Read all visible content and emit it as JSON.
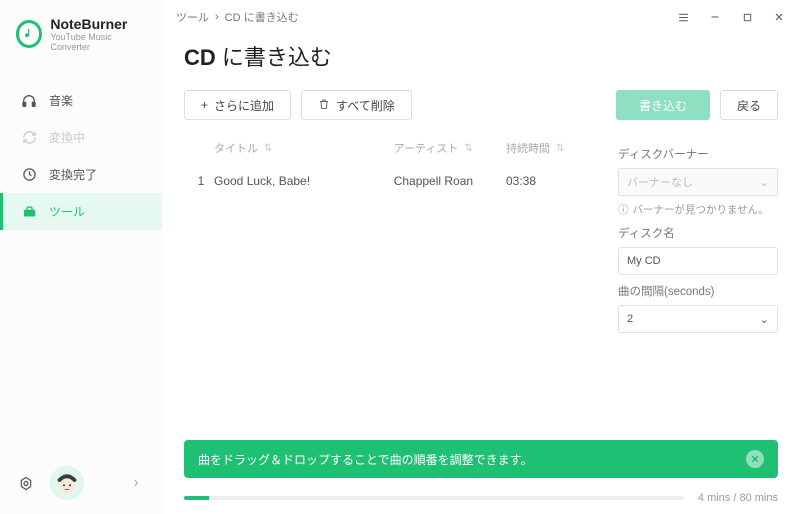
{
  "brand": {
    "title": "NoteBurner",
    "subtitle": "YouTube Music Converter"
  },
  "nav": {
    "items": [
      {
        "label": "音楽"
      },
      {
        "label": "変換中"
      },
      {
        "label": "変換完了"
      },
      {
        "label": "ツール"
      }
    ]
  },
  "breadcrumb": {
    "root": "ツール",
    "current": "CD に書き込む"
  },
  "title": {
    "bold": "CD",
    "rest": " に書き込む"
  },
  "buttons": {
    "add": "さらに追加",
    "clear": "すべて削除",
    "burn": "書き込む",
    "back": "戻る"
  },
  "columns": {
    "title": "タイトル",
    "artist": "アーティスト",
    "duration": "持続時間"
  },
  "tracks": [
    {
      "num": "1",
      "title": "Good Luck, Babe!",
      "artist": "Chappell Roan",
      "duration": "03:38"
    }
  ],
  "panel": {
    "burner_label": "ディスクバーナー",
    "burner_placeholder": "バーナーなし",
    "burner_warn": "バーナーが見つかりません。",
    "name_label": "ディスク名",
    "name_value": "My CD",
    "gap_label": "曲の間隔(seconds)",
    "gap_value": "2"
  },
  "toast": {
    "text": "曲をドラッグ＆ドロップすることで曲の順番を調整できます。"
  },
  "progress": {
    "text": "4 mins / 80 mins",
    "percent": 5
  },
  "icons": {
    "music": "music-icon",
    "converting": "refresh-icon",
    "done": "clock-icon",
    "tools": "toolbox-icon"
  }
}
